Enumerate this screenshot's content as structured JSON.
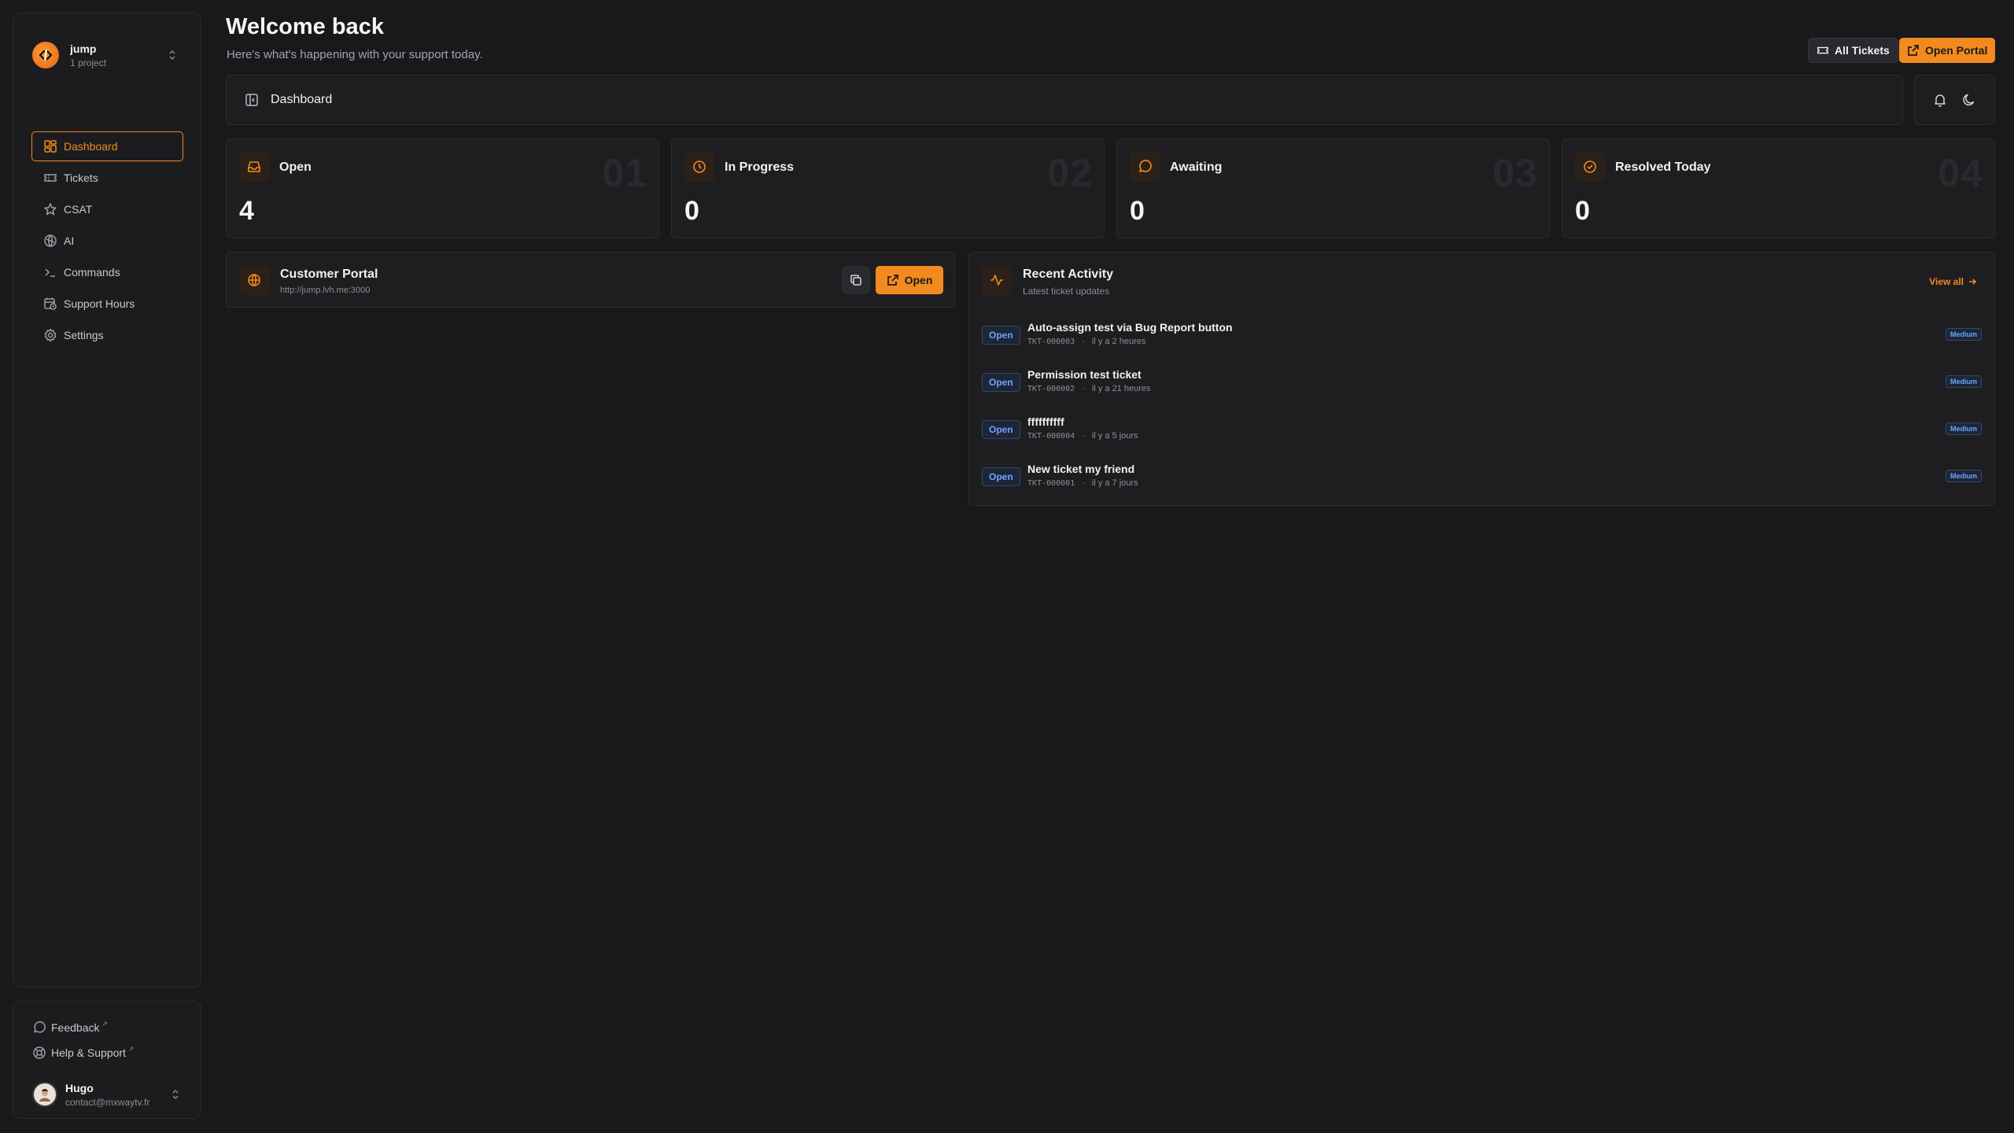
{
  "project": {
    "logo_text": "·|·",
    "name": "jump",
    "subtitle": "1 project"
  },
  "nav": {
    "items": [
      {
        "label": "Dashboard",
        "icon": "dashboard-icon",
        "active": true
      },
      {
        "label": "Tickets",
        "icon": "ticket-icon"
      },
      {
        "label": "CSAT",
        "icon": "star-icon"
      },
      {
        "label": "AI",
        "icon": "ai-icon"
      },
      {
        "label": "Commands",
        "icon": "terminal-icon"
      },
      {
        "label": "Support Hours",
        "icon": "calendar-clock-icon"
      },
      {
        "label": "Settings",
        "icon": "gear-icon"
      }
    ]
  },
  "sidebar_links": {
    "feedback": "Feedback",
    "help": "Help & Support",
    "external_mark": "↗"
  },
  "user": {
    "name": "Hugo",
    "email": "contact@mxwaytv.fr"
  },
  "header": {
    "title": "Welcome back",
    "subtitle": "Here's what's happening with your support today.",
    "all_tickets": "All Tickets",
    "open_portal": "Open Portal"
  },
  "topbar": {
    "label": "Dashboard"
  },
  "stats": [
    {
      "label": "Open",
      "value": "4",
      "number": "01",
      "icon": "inbox-icon"
    },
    {
      "label": "In Progress",
      "value": "0",
      "number": "02",
      "icon": "clock-icon"
    },
    {
      "label": "Awaiting",
      "value": "0",
      "number": "03",
      "icon": "message-icon"
    },
    {
      "label": "Resolved Today",
      "value": "0",
      "number": "04",
      "icon": "check-circle-icon"
    }
  ],
  "portal": {
    "title": "Customer Portal",
    "url": "http://jump.lvh.me:3000",
    "open_label": "Open"
  },
  "activity": {
    "title": "Recent Activity",
    "subtitle": "Latest ticket updates",
    "view_all": "View all",
    "items": [
      {
        "status": "Open",
        "title": "Auto-assign test via Bug Report button",
        "code": "TKT-000003",
        "time": "il y a 2 heures",
        "priority": "Medium"
      },
      {
        "status": "Open",
        "title": "Permission test ticket",
        "code": "TKT-000002",
        "time": "il y a 21 heures",
        "priority": "Medium"
      },
      {
        "status": "Open",
        "title": "ffffffffff",
        "code": "TKT-000004",
        "time": "il y a 5 jours",
        "priority": "Medium"
      },
      {
        "status": "Open",
        "title": "New ticket my friend",
        "code": "TKT-000001",
        "time": "il y a 7 jours",
        "priority": "Medium"
      }
    ]
  },
  "colors": {
    "accent": "#f28a1f",
    "background": "#19191c",
    "panel": "#1e1e21",
    "badge_blue": "#6fa3ff"
  }
}
